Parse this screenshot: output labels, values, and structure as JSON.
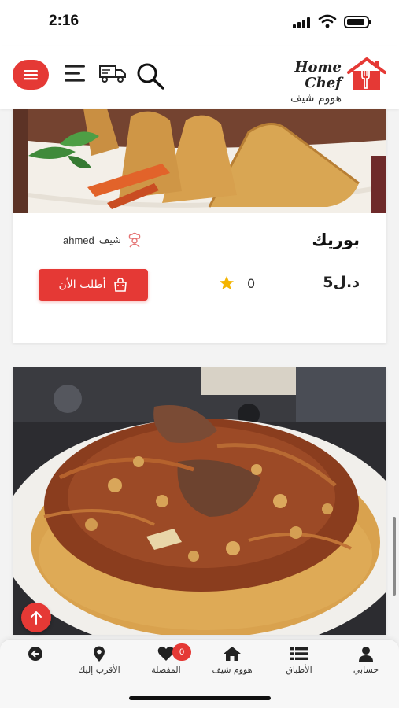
{
  "status_bar": {
    "time": "2:16"
  },
  "header": {
    "logo_en": "Home Chef",
    "logo_ar": "هووم شيف"
  },
  "dish": {
    "title": "بوريك",
    "chef_prefix": "شيف",
    "chef_name": "ahmed",
    "price": "5د.ل",
    "rating": "0",
    "order_label": "أطلب الأن"
  },
  "bottom_nav": {
    "items": [
      {
        "label": "حسابي",
        "icon": "person-icon"
      },
      {
        "label": "الأطباق",
        "icon": "list-icon"
      },
      {
        "label": "هووم شيف",
        "icon": "home-icon"
      },
      {
        "label": "المفضلة",
        "icon": "heart-icon",
        "badge": "0"
      },
      {
        "label": "الأقرب إليك",
        "icon": "location-pin-icon"
      },
      {
        "label": "",
        "icon": "back-arrow-icon"
      }
    ]
  },
  "colors": {
    "accent": "#e53935",
    "star": "#f4b400"
  }
}
